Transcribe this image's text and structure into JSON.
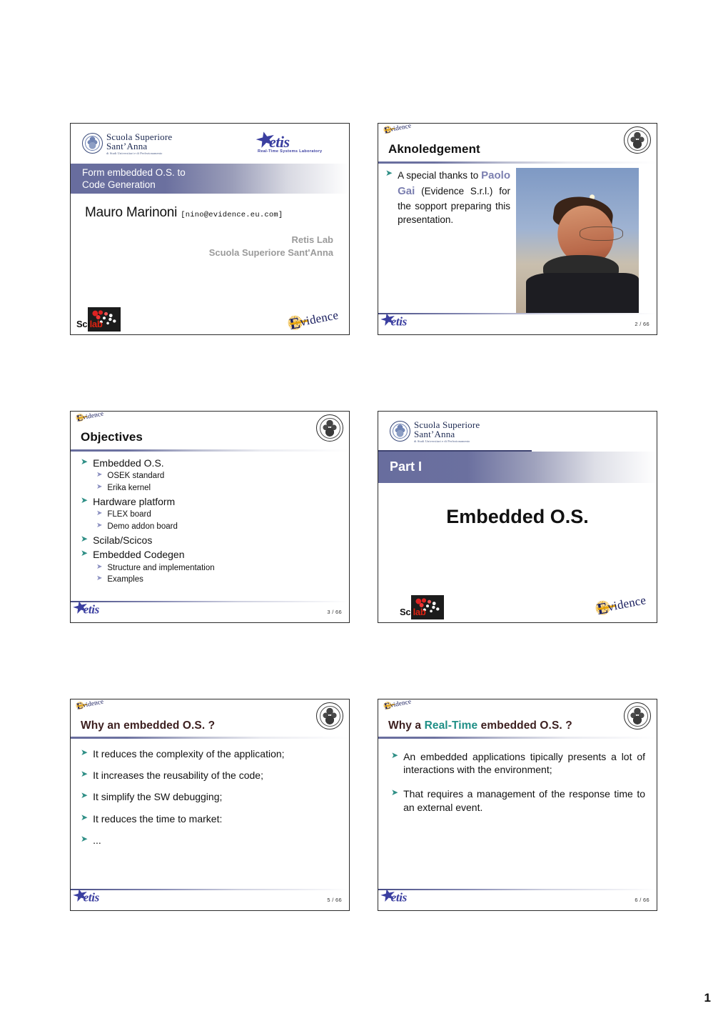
{
  "document": {
    "page_number": "1",
    "brand": {
      "university_line1": "Scuola Superiore",
      "university_line2": "Sant’Anna",
      "university_line3": "di Studi Universitari e di Perfezionamento",
      "retis_word": "etis",
      "retis_sub": "Real-Time Systems Laboratory",
      "evidence_e": "E",
      "evidence_rest": "vidence",
      "scilab_sci": "Sci",
      "scilab_lab": "lab"
    },
    "colors": {
      "band_purple": "#686d9e",
      "title_maroon": "#3c1f1f",
      "accent_teal": "#1f8f86",
      "bullet_teal": "#2f8f86",
      "bullet_lilac": "#8a8fc0",
      "name_purple": "#7b7fb0",
      "slide_border": "#2b2b2b"
    }
  },
  "slides": [
    {
      "id": "title-slide",
      "kind": "title",
      "band_lines": [
        "Form embedded O.S. to",
        "Code Generation"
      ],
      "author": "Mauro Marinoni",
      "author_email": "[nino@evidence.eu.com]",
      "affiliation_line1": "Retis Lab",
      "affiliation_line2": "Scuola Superiore Sant'Anna"
    },
    {
      "id": "aknoledgement-slide",
      "kind": "content-photo",
      "title": "Aknoledgement",
      "text_before": "A special thanks to ",
      "highlight_name": "Paolo Gai",
      "text_after": " (Evidence S.r.l.) for the sopport preparing this presentation.",
      "page": "2 / 66"
    },
    {
      "id": "objectives-slide",
      "kind": "bullets",
      "title": "Objectives",
      "bullets": [
        {
          "level": 1,
          "text": "Embedded O.S."
        },
        {
          "level": 2,
          "text": "OSEK standard"
        },
        {
          "level": 2,
          "text": "Erika kernel"
        },
        {
          "level": 1,
          "text": "Hardware platform"
        },
        {
          "level": 2,
          "text": "FLEX board"
        },
        {
          "level": 2,
          "text": "Demo addon board"
        },
        {
          "level": 1,
          "text": "Scilab/Scicos"
        },
        {
          "level": 1,
          "text": "Embedded Codegen"
        },
        {
          "level": 2,
          "text": "Structure and implementation"
        },
        {
          "level": 2,
          "text": "Examples"
        }
      ],
      "page": "3 / 66"
    },
    {
      "id": "part-one-slide",
      "kind": "part",
      "part_label": "Part I",
      "part_title": "Embedded O.S."
    },
    {
      "id": "why-embedded-os-slide",
      "kind": "bullets",
      "title": "Why an embedded O.S. ?",
      "bullets": [
        {
          "level": 1,
          "text": "It reduces the complexity of the application;"
        },
        {
          "level": 1,
          "text": "It increases the reusability of the code;"
        },
        {
          "level": 1,
          "text": "It simplify the SW debugging;"
        },
        {
          "level": 1,
          "text": "It reduces the time to market:"
        },
        {
          "level": 1,
          "text": "..."
        }
      ],
      "page": "5 / 66"
    },
    {
      "id": "why-realtime-os-slide",
      "kind": "bullets",
      "title_part1": "Why a ",
      "title_highlight": "Real-Time",
      "title_part2": " embedded O.S. ?",
      "bullets": [
        {
          "level": 1,
          "text": "An embedded applications tipically presents a lot of interactions with the environment;"
        },
        {
          "level": 1,
          "text": "That requires a management of the response time to an external event."
        }
      ],
      "page": "6 / 66"
    }
  ]
}
